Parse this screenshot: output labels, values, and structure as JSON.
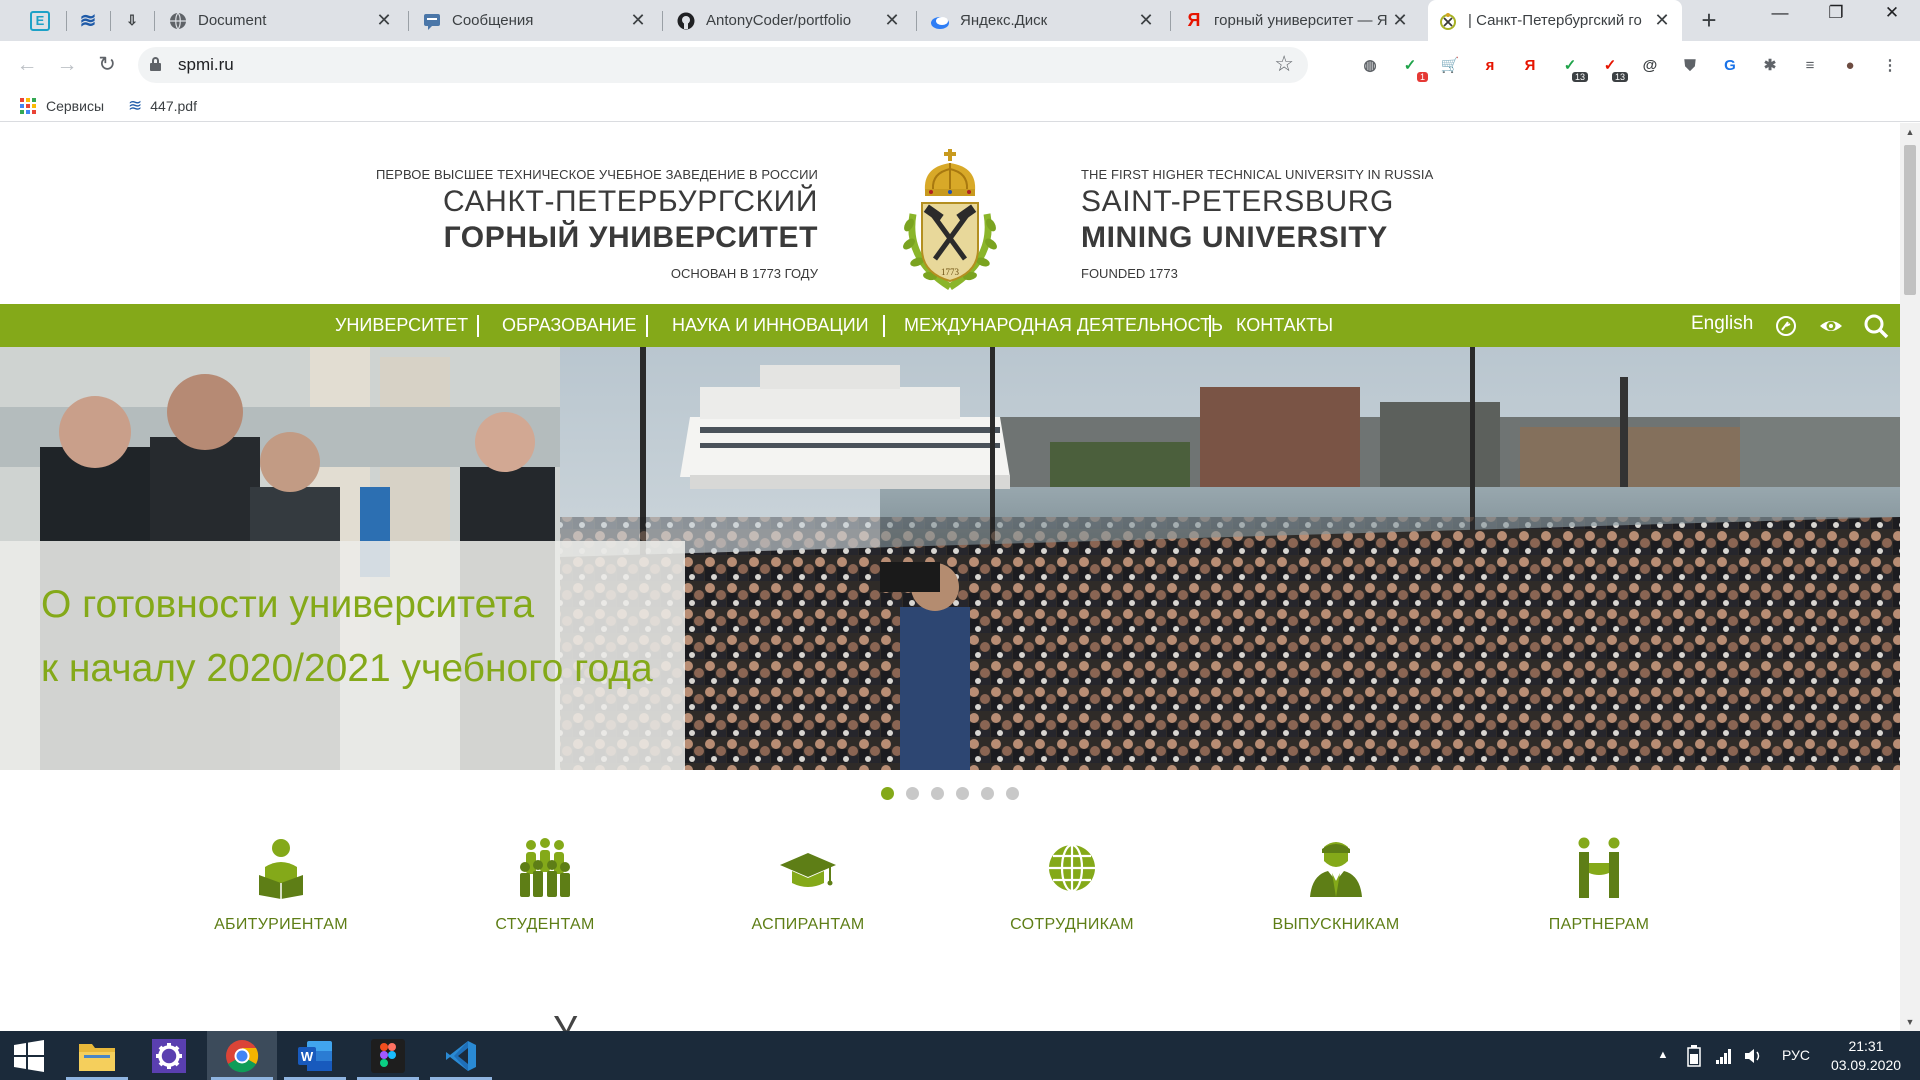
{
  "browser": {
    "tabs": [
      {
        "title": "",
        "favicon": "E",
        "favicon_color": "#1da1c7"
      },
      {
        "title": "",
        "favicon": "~",
        "favicon_color": "#1e5aa8"
      },
      {
        "title": "",
        "favicon": "↓",
        "favicon_color": "#3c4043"
      },
      {
        "title": "Document",
        "favicon": "globe",
        "favicon_color": "#5f6368"
      },
      {
        "title": "Сообщения",
        "favicon": "msg",
        "favicon_color": "#4a76a8"
      },
      {
        "title": "AntonyCoder/portfolio",
        "favicon": "github",
        "favicon_color": "#000000"
      },
      {
        "title": "Яндекс.Диск",
        "favicon": "disk",
        "favicon_color": "#2f7ef5"
      },
      {
        "title": "горный университет — Я",
        "favicon": "Я",
        "favicon_color": "#e61400"
      },
      {
        "title": "| Санкт-Петербургский го",
        "favicon": "emblem",
        "favicon_color": "#a8b224",
        "active": true
      }
    ],
    "new_tab": "+",
    "window_controls": {
      "minimize": "—",
      "restore": "❐",
      "close": "✕"
    },
    "url": "spmi.ru",
    "extensions": [
      {
        "name": "globe-icon",
        "glyph": "◍",
        "color": "#5f6368"
      },
      {
        "name": "check-icon",
        "glyph": "✓",
        "color": "#1fa34a",
        "badge": "1",
        "badge_red": true
      },
      {
        "name": "cart-icon",
        "glyph": "🛒",
        "color": "#1a73e8"
      },
      {
        "name": "yandex-icon",
        "glyph": "я",
        "color": "#e61400"
      },
      {
        "name": "yandex-browser-icon",
        "glyph": "Я",
        "color": "#e61400"
      },
      {
        "name": "message-icon",
        "glyph": "✓",
        "color": "#1fa34a",
        "badge": "13"
      },
      {
        "name": "opera-icon",
        "glyph": "✓",
        "color": "#e61400",
        "badge": "13"
      },
      {
        "name": "at-icon",
        "glyph": "@",
        "color": "#3c4043"
      },
      {
        "name": "shield-icon",
        "glyph": "⛊",
        "color": "#5f6368"
      },
      {
        "name": "translate-icon",
        "glyph": "G",
        "color": "#1a73e8"
      },
      {
        "name": "puzzle-icon",
        "glyph": "✱",
        "color": "#5f6368"
      },
      {
        "name": "playlist-icon",
        "glyph": "≡",
        "color": "#5f6368"
      },
      {
        "name": "avatar-icon",
        "glyph": "●",
        "color": "#6d4c41"
      },
      {
        "name": "menu-icon",
        "glyph": "⋮",
        "color": "#5f6368"
      }
    ],
    "bookmarks": [
      {
        "label": "Сервисы"
      },
      {
        "label": "447.pdf"
      }
    ]
  },
  "site": {
    "header": {
      "ru_tagline": "ПЕРВОЕ ВЫСШЕЕ ТЕХНИЧЕСКОЕ УЧЕБНОЕ ЗАВЕДЕНИЕ В РОССИИ",
      "ru_name_line1": "САНКТ-ПЕТЕРБУРГСКИЙ",
      "ru_name_line2": "ГОРНЫЙ УНИВЕРСИТЕТ",
      "ru_founded": "ОСНОВАН В 1773 ГОДУ",
      "en_tagline": "THE FIRST HIGHER TECHNICAL UNIVERSITY IN RUSSIA",
      "en_name_line1": "SAINT-PETERSBURG",
      "en_name_line2": "MINING UNIVERSITY",
      "en_founded": "FOUNDED 1773",
      "emblem_year": "1773"
    },
    "menu": {
      "items": [
        "УНИВЕРСИТЕТ",
        "ОБРАЗОВАНИЕ",
        "НАУКА И ИННОВАЦИИ",
        "МЕЖДУНАРОДНАЯ ДЕЯТЕЛЬНОСТЬ",
        "КОНТАКТЫ"
      ],
      "language": "English"
    },
    "hero": {
      "caption_line1": "О готовности университета",
      "caption_line2": "к началу 2020/2021 учебного года",
      "slides": 6,
      "active_slide": 1
    },
    "audiences": [
      "АБИТУРИЕНТАМ",
      "СТУДЕНТАМ",
      "АСПИРАНТАМ",
      "СОТРУДНИКАМ",
      "ВЫПУСКНИКАМ",
      "ПАРТНЕРАМ"
    ],
    "peek_text": "У"
  },
  "colors": {
    "brand_green": "#84a919",
    "dark_green": "#5e7e16",
    "taskbar": "#1b2a3a"
  },
  "taskbar": {
    "language": "РУС",
    "time": "21:31",
    "date": "03.09.2020"
  }
}
